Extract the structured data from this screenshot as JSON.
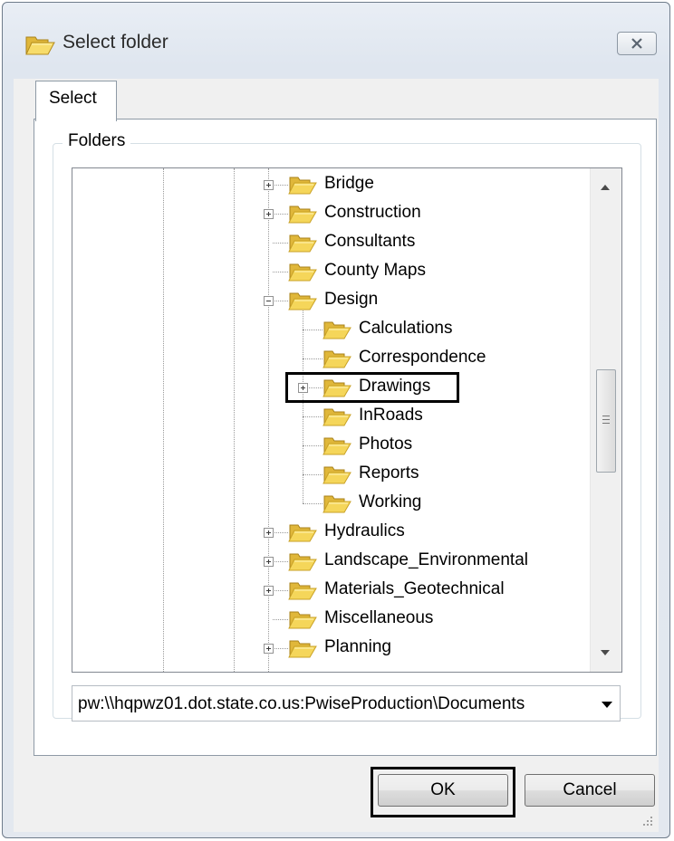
{
  "window": {
    "title": "Select folder",
    "icon": "folder-icon",
    "close_icon": "close-icon"
  },
  "tabs": [
    {
      "label": "Select",
      "selected": true
    }
  ],
  "folders_group": {
    "legend": "Folders"
  },
  "tree": {
    "items": [
      {
        "label": "Bridge",
        "expander": "plus",
        "level": 0
      },
      {
        "label": "Construction",
        "expander": "plus",
        "level": 0
      },
      {
        "label": "Consultants",
        "expander": "none",
        "level": 0
      },
      {
        "label": "County Maps",
        "expander": "none",
        "level": 0
      },
      {
        "label": "Design",
        "expander": "minus",
        "level": 0
      },
      {
        "label": "Calculations",
        "expander": "none",
        "level": 1
      },
      {
        "label": "Correspondence",
        "expander": "none",
        "level": 1
      },
      {
        "label": "Drawings",
        "expander": "plus",
        "level": 1,
        "highlighted": true
      },
      {
        "label": "InRoads",
        "expander": "none",
        "level": 1
      },
      {
        "label": "Photos",
        "expander": "none",
        "level": 1
      },
      {
        "label": "Reports",
        "expander": "none",
        "level": 1
      },
      {
        "label": "Working",
        "expander": "none",
        "level": 1
      },
      {
        "label": "Hydraulics",
        "expander": "plus",
        "level": 0
      },
      {
        "label": "Landscape_Environmental",
        "expander": "plus",
        "level": 0
      },
      {
        "label": "Materials_Geotechnical",
        "expander": "plus",
        "level": 0
      },
      {
        "label": "Miscellaneous",
        "expander": "none",
        "level": 0
      },
      {
        "label": "Planning",
        "expander": "plus",
        "level": 0
      }
    ]
  },
  "path": {
    "value": "pw:\\\\hqpwz01.dot.state.co.us:PwiseProduction\\Documents"
  },
  "buttons": {
    "ok": "OK",
    "cancel": "Cancel"
  },
  "colors": {
    "folder_fill": "#f5d65a",
    "folder_dark": "#c9a227",
    "highlight_border": "#000000"
  }
}
